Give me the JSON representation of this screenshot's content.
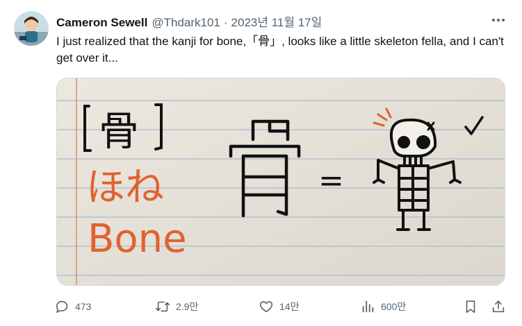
{
  "tweet": {
    "author_name": "Cameron Sewell",
    "handle": "@Thdark101",
    "separator": "·",
    "date": "2023년 11월 17일",
    "text": "I just realized that the kanji for bone,「骨」, looks like a little skeleton fella, and I can't get over it..."
  },
  "media": {
    "kanji_bracketed": "骨",
    "reading": "ほね",
    "english": "Bone",
    "big_kanji": "骨",
    "equals": "="
  },
  "actions": {
    "replies": "473",
    "retweets": "2.9만",
    "likes": "14만",
    "views": "600만"
  },
  "icons": {
    "more": "more-horizontal-icon",
    "reply": "speech-bubble-icon",
    "retweet": "retweet-arrows-icon",
    "like": "heart-icon",
    "views": "bar-chart-icon",
    "bookmark": "bookmark-icon",
    "share": "share-upload-icon"
  },
  "colors": {
    "text_primary": "#0f1419",
    "text_secondary": "#536471",
    "ink_red": "#e0622e",
    "ink_black": "#111111",
    "paper": "#e8e4dc",
    "ruled_line": "#9bb0c8",
    "margin_line": "#d9826e"
  }
}
